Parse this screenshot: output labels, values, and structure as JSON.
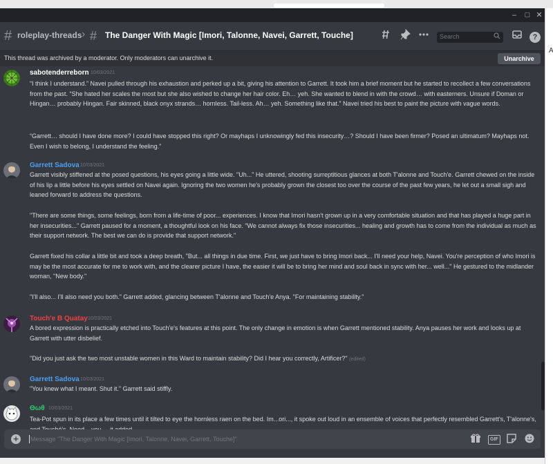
{
  "header": {
    "parent_channel": "roleplay-threads",
    "thread_title": "The Danger With Magic [Imori, Talonne, Navei, Garrett, Touche]",
    "search_placeholder": "Search"
  },
  "banner": {
    "text": "This thread was archived by a moderator. Only moderators can unarchive it.",
    "button": "Unarchive"
  },
  "messages": [
    {
      "author": "sabotenderreborn",
      "author_color": "#ffffff",
      "time": "10/03/2021",
      "paragraphs": [
        "“I think I understand.” Navei pulled through his exhaustion and perked up a bit, giving his attention to Garrett. It took him a brief moment but he started to recollect a few conversations from the past. “She hated her scales the most but she also wished to change her hair color. Eh… yeh. She wanted to blend in with the crowd… with easterners. Unsure if Doman or Hingan… probably Hingan. Fair skinned, black onyx strands… hornless. Tail-less. Ah… yeh. Something like that.” Navei tried his best to paint the picture with vague words.",
        "“Garrett… should I have done more? I could have stopped this right? Or mayhaps I unknowingly fed this insecurity…? Should I have been firmer? Posed an ultimatum? Mayhaps not. Even I wish to belong, I understand the feeling.”"
      ]
    },
    {
      "author": "Garrett Sadova",
      "author_color": "#4ba0f0",
      "time": "10/03/2021",
      "paragraphs": [
        "Garrett visibly stiffened at the posed questions, his eyes going a little wide. \"Uh...\" He uttered, shooting surreptitious glances at both T'alonne and Touch'e. Garrett chewed on the inside of his lip a little before his eyes settled on Navei again. Ignoring the two women he's probably grown the closest too over the course of the past few years, he let out a small sigh and leaned forward to address the questions.",
        "\"There are some things, some feelings, born from a life-time of poor... experiences. I know that Imori hasn't grown up in a very comfortable situation and that has played a huge part in her insecurities...\" Garrett paused for a moment, a thoughtful look on his face. \"We cannot always fix those insecurities... healing and growth has to come from the individual as much as their support network. The best we can do is provide that support network.\"",
        "Garrett fixed his collar a little bit and took a deep breath, \"But... all things in due time. First, we just have to bring Imori back... I'll need your help, Navei. You're perception of who Imori is may be the most accurate for me to work with, and the clearer picture I have, the easier it will be to bring her mind and soul back in sync with her... well...\" He gestured to the midlander woman, \"New body.\"",
        "\"I'll also... I'll also need you both.\" Garrett added, glancing between T'alonne and Touch'e Anya. \"For maintaining stability.\""
      ]
    },
    {
      "author": "Touch'e B Quatay",
      "author_color": "#ed4245",
      "time": "10/03/2021",
      "paragraphs": [
        "A bored expression is practically etched into Touch'e's features at this point. The only change in emotion is when Garrett mentioned stability. Anya pauses her work and looks up at Garrett with utter disbelief.",
        "\"Did you just ask the two most unstable women in this Ward to maintain stability? Did I hear you correctly, Artificer?\""
      ],
      "edited_label": "(edited)"
    },
    {
      "author": "Garrett Sadova",
      "author_color": "#4ba0f0",
      "time": "10/03/2021",
      "paragraphs": [
        "\"You knew what I meant. Shut it.\" Garrett said stiffly."
      ]
    },
    {
      "author": "Θωθ",
      "author_color": "#2ecc71",
      "time": "10/03/2021",
      "paragraphs": [
        "Tea-Pot spun in its place a few times until it tilted to eye the hornless raen on the bed. Im...ori..., it spoke out loud in an ensemble of voices that perfectly resembled Garrett's, T'alonne's, and Touché's. Need... you..., it added."
      ]
    }
  ],
  "composer": {
    "placeholder": "Message \"The Danger With Magic [Imori, Talonne, Navei, Garrett, Touche]\"",
    "gif_label": "GIF"
  },
  "icons": [
    "threads-icon",
    "pin-icon",
    "more-icon",
    "search-icon",
    "inbox-icon",
    "help-icon",
    "add-attachment-icon",
    "gift-icon",
    "gif-icon",
    "sticker-icon",
    "emoji-icon"
  ],
  "colors": {
    "accent": "#5865f2",
    "background": "#36393f",
    "sidebar": "#2f3136",
    "input": "#40444b"
  },
  "window_controls": {
    "minimize": "–",
    "maximize": "□",
    "close": "✕"
  },
  "help_glyph": "?",
  "clipped_edge_char": "A"
}
